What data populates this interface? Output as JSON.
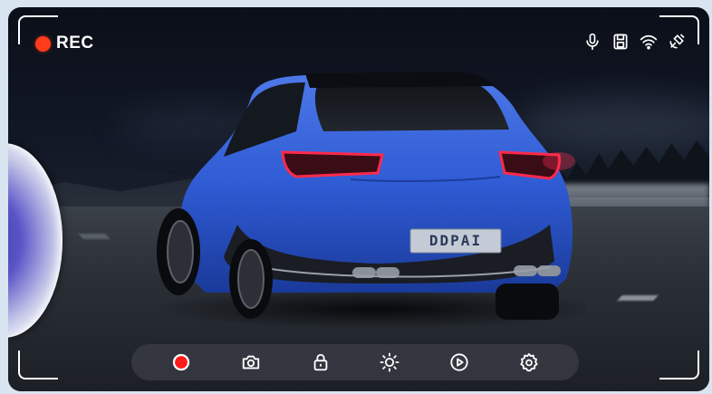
{
  "recording": {
    "label": "REC",
    "dot_color": "#ff3b1a"
  },
  "status_icons": [
    "microphone-icon",
    "sd-card-icon",
    "wifi-icon",
    "gps-satellite-icon"
  ],
  "vehicle": {
    "plate_text": "DDPAI",
    "body_color": "#2f5bd4",
    "taillight_color": "#ff2a4a"
  },
  "controls": [
    {
      "name": "record-button",
      "icon": "record-dot-icon",
      "color": "#ff1a1a"
    },
    {
      "name": "snapshot-button",
      "icon": "camera-icon"
    },
    {
      "name": "lock-button",
      "icon": "lock-icon"
    },
    {
      "name": "brightness-button",
      "icon": "sun-icon"
    },
    {
      "name": "playback-button",
      "icon": "play-circle-icon"
    },
    {
      "name": "settings-button",
      "icon": "gear-icon"
    }
  ],
  "colors": {
    "accent_red": "#ff3b1a",
    "overlay_white": "#ffffff",
    "bar_background": "rgba(60,62,72,0.72)"
  }
}
